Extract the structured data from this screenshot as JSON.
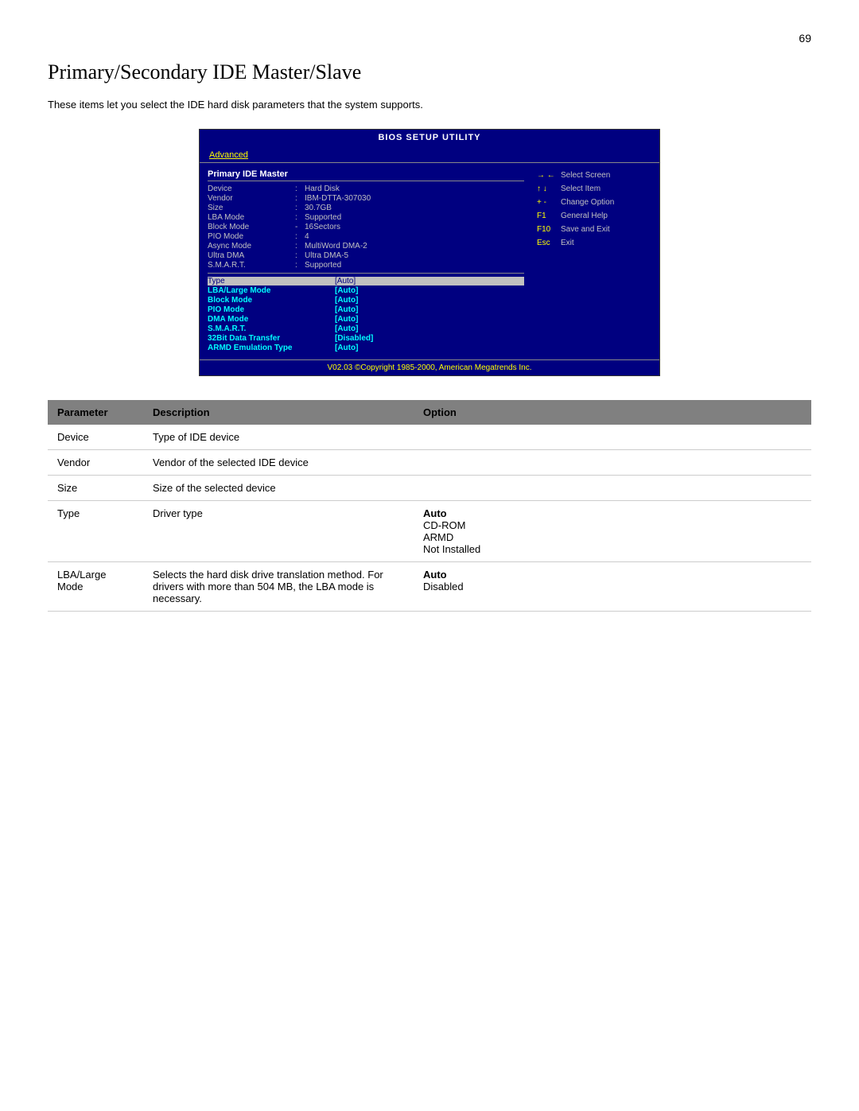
{
  "page": {
    "number": "69",
    "title": "Primary/Secondary IDE Master/Slave",
    "intro": "These items let you select the IDE hard disk parameters that the system supports."
  },
  "bios": {
    "title": "BIOS SETUP UTILITY",
    "nav_item": "Advanced",
    "section_title": "Primary IDE Master",
    "static_items": [
      {
        "label": "Device",
        "colon": ":",
        "value": "Hard Disk"
      },
      {
        "label": "Vendor",
        "colon": ":",
        "value": "IBM-DTTA-307030"
      },
      {
        "label": "Size",
        "colon": ":",
        "value": "30.7GB"
      },
      {
        "label": "LBA Mode",
        "colon": ":",
        "value": "Supported"
      },
      {
        "label": "Block Mode",
        "colon": "-",
        "value": "16Sectors"
      },
      {
        "label": "PIO Mode",
        "colon": ":",
        "value": "4"
      },
      {
        "label": "Async Mode",
        "colon": ":",
        "value": "MultiWord DMA-2"
      },
      {
        "label": "Ultra DMA",
        "colon": ":",
        "value": "Ultra DMA-5"
      },
      {
        "label": "S.M.A.R.T.",
        "colon": ":",
        "value": "Supported"
      }
    ],
    "active_items": [
      {
        "label": "Type",
        "value": "[Auto]",
        "highlight": true
      },
      {
        "label": "LBA/Large Mode",
        "value": "[Auto]"
      },
      {
        "label": "Block Mode",
        "value": "[Auto]"
      },
      {
        "label": "PIO Mode",
        "value": "[Auto]"
      },
      {
        "label": "DMA Mode",
        "value": "[Auto]"
      },
      {
        "label": "S.M.A.R.T.",
        "value": "[Auto]"
      },
      {
        "label": "32Bit Data Transfer",
        "value": "[Disabled]"
      },
      {
        "label": "ARMD Emulation Type",
        "value": "[Auto]"
      }
    ],
    "keys": [
      {
        "sym": "→ ←",
        "desc": "Select Screen"
      },
      {
        "sym": "↑ ↓",
        "desc": "Select Item"
      },
      {
        "sym": "+ -",
        "desc": "Change Option"
      },
      {
        "sym": "F1",
        "desc": "General Help"
      },
      {
        "sym": "F10",
        "desc": "Save and Exit"
      },
      {
        "sym": "Esc",
        "desc": "Exit"
      }
    ],
    "footer": "V02.03 ©Copyright 1985-2000, American Megatrends Inc."
  },
  "table": {
    "headers": [
      "Parameter",
      "Description",
      "Option"
    ],
    "rows": [
      {
        "param": "Device",
        "desc": "Type of IDE device",
        "option": "",
        "option_bold": false,
        "option_items": []
      },
      {
        "param": "Vendor",
        "desc": "Vendor of the selected IDE device",
        "option": "",
        "option_bold": false,
        "option_items": []
      },
      {
        "param": "Size",
        "desc": "Size of the selected device",
        "option": "",
        "option_bold": false,
        "option_items": []
      },
      {
        "param": "Type",
        "desc": "Driver type",
        "option": "Auto",
        "option_bold": true,
        "option_items": [
          "CD-ROM",
          "ARMD",
          "Not Installed"
        ]
      },
      {
        "param": "LBA/Large Mode",
        "desc": "Selects the hard disk drive translation method.  For drivers with more than 504 MB, the LBA mode is necessary.",
        "option": "Auto",
        "option_bold": true,
        "option_items": [
          "Disabled"
        ]
      }
    ]
  }
}
